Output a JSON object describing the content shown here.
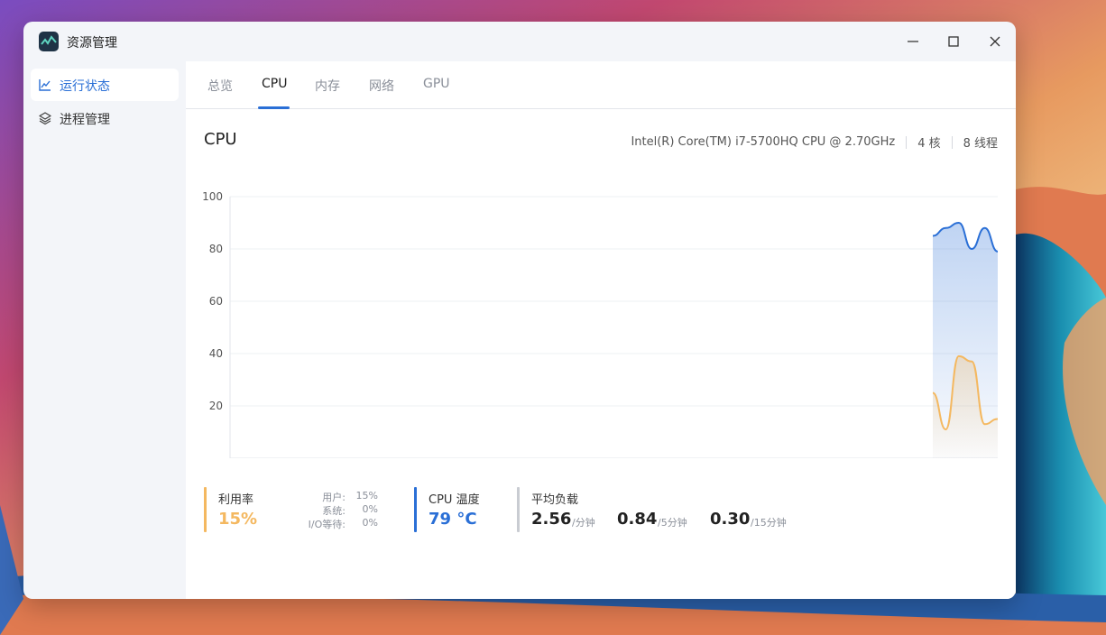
{
  "app": {
    "title": "资源管理"
  },
  "colors": {
    "accent": "#2a6fd6",
    "orange": "#f4b860",
    "cpu_line": "#2a6fd6"
  },
  "sidebar": {
    "items": [
      {
        "label": "运行状态",
        "icon": "chart-line-icon",
        "active": true
      },
      {
        "label": "进程管理",
        "icon": "layers-icon",
        "active": false
      }
    ]
  },
  "tabs": [
    {
      "label": "总览"
    },
    {
      "label": "CPU",
      "active": true
    },
    {
      "label": "内存"
    },
    {
      "label": "网络"
    },
    {
      "label": "GPU"
    }
  ],
  "cpu": {
    "heading": "CPU",
    "model": "Intel(R) Core(TM) i7-5700HQ CPU @ 2.70GHz",
    "cores": "4 核",
    "threads": "8 线程"
  },
  "chart_data": {
    "type": "area",
    "ylim": [
      0,
      100
    ],
    "yticks": [
      "100",
      "80",
      "60",
      "40",
      "20"
    ],
    "grid": true,
    "series": [
      {
        "color": "#2a6fd6",
        "values": [
          85,
          88,
          90,
          80,
          88,
          79
        ]
      },
      {
        "color": "#f4b860",
        "values": [
          25,
          11,
          39,
          37,
          13,
          15
        ]
      }
    ]
  },
  "stats": {
    "usage": {
      "label": "利用率",
      "value": "15%",
      "details": [
        {
          "key": "用户:",
          "value": "15%"
        },
        {
          "key": "系统:",
          "value": "0%"
        },
        {
          "key": "I/O等待:",
          "value": "0%"
        }
      ]
    },
    "temp": {
      "label": "CPU 温度",
      "value": "79 °C"
    },
    "load": {
      "label": "平均负载",
      "items": [
        {
          "value": "2.56",
          "unit": "/分钟"
        },
        {
          "value": "0.84",
          "unit": "/5分钟"
        },
        {
          "value": "0.30",
          "unit": "/15分钟"
        }
      ]
    }
  }
}
